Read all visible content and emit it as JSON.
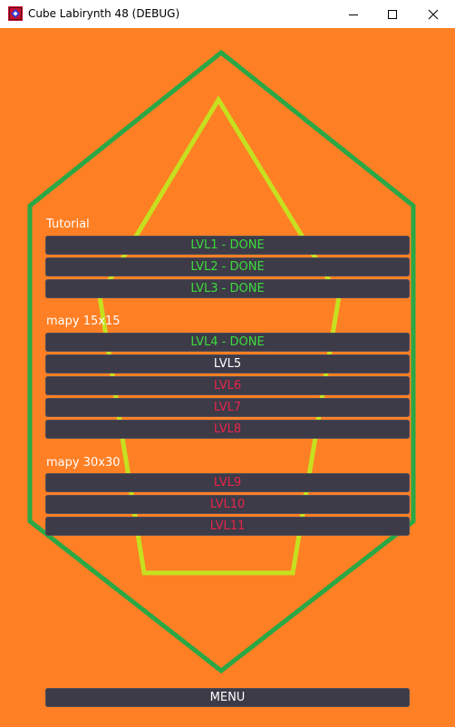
{
  "window": {
    "title": "Cube Labirynth 48 (DEBUG)",
    "icon": "app-icon",
    "controls": [
      "minimize-icon",
      "maximize-icon",
      "close-icon"
    ]
  },
  "colors": {
    "background": "#ff7f24",
    "hexagon_outline": "#2aa845",
    "inner_shape_outline": "#c6e01f",
    "button_bg": "#3c3b47",
    "done_text": "#3ddc3d",
    "open_text": "#ffffff",
    "locked_text": "#e8244b"
  },
  "sections": [
    {
      "label": "Tutorial",
      "levels": [
        {
          "label": "LVL1 - DONE",
          "state": "done"
        },
        {
          "label": "LVL2 - DONE",
          "state": "done"
        },
        {
          "label": "LVL3 - DONE",
          "state": "done"
        }
      ]
    },
    {
      "label": "mapy 15x15",
      "levels": [
        {
          "label": "LVL4 - DONE",
          "state": "done"
        },
        {
          "label": "LVL5",
          "state": "open"
        },
        {
          "label": "LVL6",
          "state": "locked"
        },
        {
          "label": "LVL7",
          "state": "locked"
        },
        {
          "label": "LVL8",
          "state": "locked"
        }
      ]
    },
    {
      "label": "mapy 30x30",
      "levels": [
        {
          "label": "LVL9",
          "state": "locked"
        },
        {
          "label": "LVL10",
          "state": "locked"
        },
        {
          "label": "LVL11",
          "state": "locked"
        }
      ]
    }
  ],
  "menu_button": {
    "label": "MENU"
  }
}
